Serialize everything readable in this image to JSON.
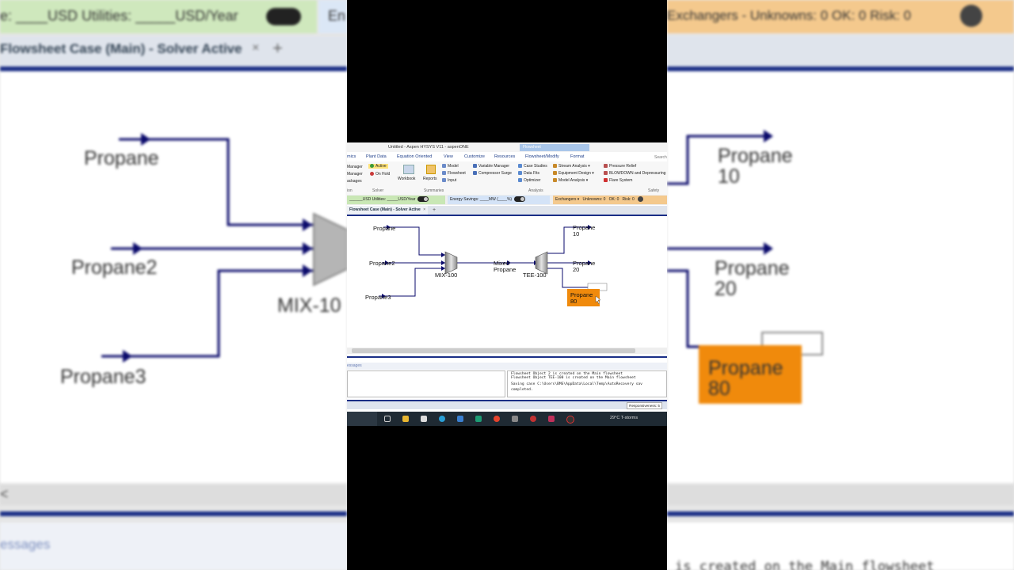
{
  "window": {
    "title": "Untitled - Aspen HYSYS V11 - aspenONE",
    "context_tab": "Flowsheet"
  },
  "menu": [
    "mics",
    "Plant Data",
    "Equation Oriented",
    "View",
    "Customize",
    "Resources",
    "Flowsheet/Modify",
    "Format"
  ],
  "ribbon": {
    "col1": [
      "Manager",
      "Manager",
      "ackages"
    ],
    "solver_active": "Active",
    "solver_onhold": "On Hold",
    "workbook": "Workbook",
    "reports": "Reports",
    "summaries": [
      "Model",
      "Flowsheet",
      "Input"
    ],
    "analysis_a": [
      "Variable Manager",
      "Compressor Surge"
    ],
    "analysis_b": [
      "Case Studies",
      "Data Fits",
      "Optimizer"
    ],
    "analysis_c": [
      "Stream Analysis",
      "Equipment Design",
      "Model Analysis"
    ],
    "safety": [
      "Pressure Relief",
      "BLOWDOWN and Depressuring",
      "Flare System"
    ],
    "search": "Search",
    "groups": [
      "ion",
      "Solver",
      "Summaries",
      "Analysis",
      "Safety"
    ]
  },
  "statusbar": {
    "cost": "______USD  Utilities: _____USD/Year",
    "energy": "Energy Savings: ____MW   (____%)",
    "exchangers": "Exchangers",
    "unknowns": "Unknowns: 0",
    "ok": "OK: 0",
    "risk": "Risk: 0"
  },
  "doc_tab": {
    "label": "Flowsheet Case (Main) - Solver Active",
    "add": "+"
  },
  "flowsheet": {
    "streams": {
      "propane": "Propane",
      "propane2": "Propane2",
      "propane3": "Propane3",
      "mixed_line1": "Mixed",
      "mixed_line2": "Propane",
      "p10_line1": "Propane",
      "p10_line2": "10",
      "p20_line1": "Propane",
      "p20_line2": "20",
      "p80_line1": "Propane",
      "p80_line2": "80"
    },
    "units": {
      "mixer": "MIX-100",
      "tee": "TEE-100"
    }
  },
  "messages": {
    "header": "essages",
    "lines": [
      "Flowsheet Object 2 is created on the Main flowsheet",
      "Flowsheet Object TEE-100 is created on the Main flowsheet",
      "Saving case C:\\Users\\BMS\\AppData\\Local\\Temp\\AutoRecovery sav",
      "completed."
    ]
  },
  "app_status": {
    "responsiveness": "Responsiveness: 5"
  },
  "taskbar": {
    "weather": "29°C  T-storms"
  },
  "background_left": {
    "top_status": "e:  ____USD   Utilities: _____USD/Year",
    "top_tab": "En",
    "doc_tab": "Flowsheet Case (Main) - Solver Active",
    "propane": "Propane",
    "propane2": "Propane2",
    "propane3": "Propane3",
    "mixer": "MIX-10",
    "scroll_arrow": "<",
    "messages": "essages"
  },
  "background_right": {
    "top_status": "Exchangers -  Unknowns: 0   OK: 0   Risk: 0",
    "p10_line1": "Propane",
    "p10_line2": "10",
    "p20_line1": "Propane",
    "p20_line2": "20",
    "p80_line1": "Propane",
    "p80_line2": "80",
    "message": "is created on the Main flowsheet"
  },
  "colors": {
    "stream_line": "#0a0a6b",
    "highlight_stream": "#f08a0c",
    "accent_blue": "#1a2e86",
    "statusbar_green": "#c9e7b5",
    "statusbar_blue": "#d4e3f7",
    "statusbar_orange": "#f4c98d"
  }
}
